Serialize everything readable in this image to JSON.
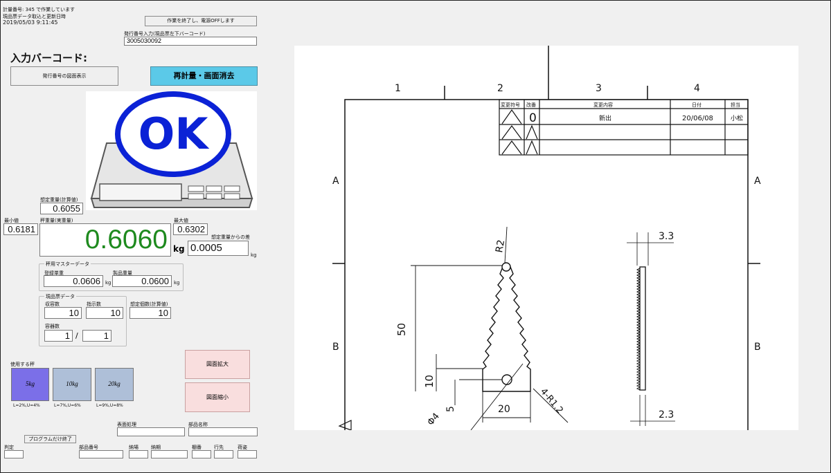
{
  "status": {
    "line1": "計量番号: 345 で作業しています",
    "line2": "現品票データ取込と更新日時",
    "datetime": "2019/05/03 9:11:45"
  },
  "buttons": {
    "exit_power": "作業を終了し、電源OFFします",
    "show_drawing": "発行番号の図面表示",
    "reweigh": "再計量・画面消去",
    "zoom_in": "図面拡大",
    "zoom_out": "図面縮小",
    "program_exit": "プログラムだけ終了"
  },
  "barcode": {
    "label": "発行番号入力(現品票左下バーコード)",
    "value": "3005030092",
    "heading": "入力バーコード:"
  },
  "result": {
    "badge": "OK",
    "status_color": "#0b22d6"
  },
  "weights": {
    "expected_label": "想定重量(計算値)",
    "expected": "0.6055",
    "min_label": "最小値",
    "min": "0.6181",
    "max_label": "最大値",
    "max": "0.6302",
    "measured_label": "秤重量(実重量)",
    "measured": "0.6060",
    "unit": "kg",
    "diff_label": "想定重量からの差",
    "diff": "0.0005",
    "diff_unit": "kg",
    "measured_color": "#1e8a1e"
  },
  "master": {
    "title": "秤用マスターデータ",
    "unit_label": "登録単重",
    "unit": "0.0606",
    "unit_unit": "kg",
    "product_label": "製品重量",
    "product": "0.0600",
    "product_unit": "kg"
  },
  "slip": {
    "title": "現品票データ",
    "capacity_label": "収容数",
    "capacity": "10",
    "instruct_label": "指示数",
    "instruct": "10",
    "expected_count_label": "想定個数(計算値)",
    "expected_count": "10",
    "container_label": "容器数",
    "container": "1",
    "slash": "/",
    "container_total": "1"
  },
  "scales": {
    "label": "使用する秤",
    "items": [
      {
        "name": "5kg",
        "tol": "L=2%,U=4%",
        "color": "#7b6fe8"
      },
      {
        "name": "10kg",
        "tol": "L=7%,U=6%",
        "color": "#aebfd8"
      },
      {
        "name": "20kg",
        "tol": "L=9%,U=8%",
        "color": "#aebfd8"
      }
    ]
  },
  "fields": {
    "surface": "表面処理",
    "part_name": "部品名称",
    "judge": "判定",
    "part_no": "部品番号",
    "delivery_place": "納場",
    "delivery_date": "納期",
    "shelf": "棚番",
    "dest": "行先",
    "packing": "荷姿"
  },
  "drawing": {
    "cols": [
      "1",
      "2",
      "3",
      "4"
    ],
    "rows": [
      "A",
      "B"
    ],
    "rev_headers": [
      "変更符号",
      "改番",
      "変更内容",
      "日付",
      "担当"
    ],
    "rev_row": {
      "no": "0",
      "content": "新出",
      "date": "20/06/08",
      "person": "小松"
    },
    "dims": {
      "r2": "R2",
      "h50": "50",
      "h10": "10",
      "h5": "5",
      "w20": "20",
      "r12": "4-R1.2",
      "phi4": "Φ4",
      "t33": "3.3",
      "t23": "2.3"
    }
  }
}
